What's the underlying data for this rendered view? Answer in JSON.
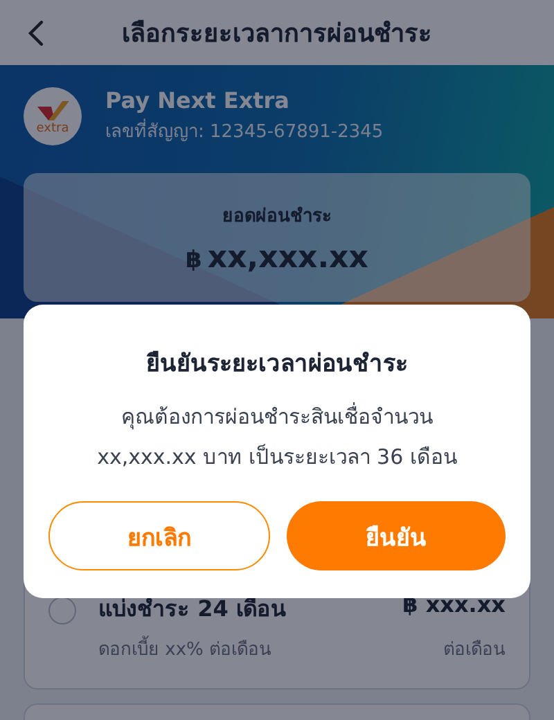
{
  "header": {
    "title": "เลือกระยะเวลาการผ่อนชำระ"
  },
  "account": {
    "logo_text": "extra",
    "name": "Pay Next Extra",
    "contract": "เลขที่สัญญา: 12345-67891-2345"
  },
  "summary": {
    "label": "ยอดผ่อนชำระ",
    "currency": "฿",
    "amount": "xx,xxx.xx"
  },
  "options": [
    {
      "title": "แบ่งชำระ 24 เดือน",
      "rate": "ดอกเบี้ย xx% ต่อเดือน",
      "amount": "฿ xxx.xx",
      "per": "ต่อเดือน",
      "selected": false
    }
  ],
  "dialog": {
    "title": "ยืนยันระยะเวลาผ่อนชำระ",
    "message_lines": [
      "คุณต้องการผ่อนชำระสินเชื่อจำนวน",
      "xx,xxx.xx บาท เป็นระยะเวลา 36 เดือน"
    ],
    "buttons": [
      {
        "label": "ยกเลิก",
        "kind": "secondary"
      },
      {
        "label": "ยืนยัน",
        "kind": "primary"
      }
    ]
  }
}
